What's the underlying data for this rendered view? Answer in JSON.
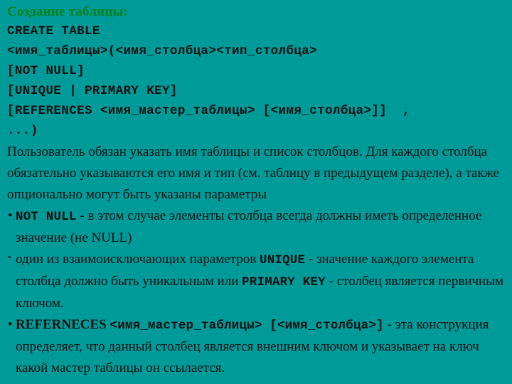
{
  "slide": {
    "background_color": "#009a99",
    "text_color": "#111111",
    "heading_color": "#00801a",
    "heading": "Создание таблицы:",
    "syntax_lines": [
      "CREATE TABLE",
      "<имя_таблицы>(<имя_столбца><тип_столбца>",
      "[NOT NULL]",
      "[UNIQUE | PRIMARY KEY]",
      "[REFERENCES <имя_мастер_таблицы> [<имя_столбца>]]  ,",
      "...)"
    ],
    "paragraph": "Пользователь обязан указать имя таблицы и список столбцов. Для каждого столбца обязательно указываются его имя и тип (см. таблицу в предыдущем разделе), а также опционально могут быть указаны параметры",
    "bullets": [
      {
        "marker": "•",
        "marker_size": "large",
        "parts": [
          {
            "text": "NOT NULL",
            "style": "mono"
          },
          {
            "text": " - в этом случае элементы столбца всегда должны иметь определенное значение (не NULL)",
            "style": "serif"
          }
        ]
      },
      {
        "marker": "•",
        "marker_size": "small",
        "parts": [
          {
            "text": "один из взаимоисключающих параметров ",
            "style": "serif"
          },
          {
            "text": "UNIQUE",
            "style": "mono"
          },
          {
            "text": " - значение каждого элемента столбца должно быть уникальным или ",
            "style": "serif"
          },
          {
            "text": "PRIMARY KEY",
            "style": "mono"
          },
          {
            "text": " - столбец является первичным ключом.",
            "style": "serif"
          }
        ]
      },
      {
        "marker": "•",
        "marker_size": "large",
        "parts": [
          {
            "text": "REFERNECES",
            "style": "serif-bold"
          },
          {
            "text": " ",
            "style": "serif"
          },
          {
            "text": "<имя_мастер_таблицы> [<имя_столбца>]",
            "style": "mono"
          },
          {
            "text": " - эта конструкция определяет, что данный столбец является внешним ключом и указывает на ключ какой мастер  таблицы он ссылается.",
            "style": "serif"
          }
        ]
      }
    ]
  }
}
